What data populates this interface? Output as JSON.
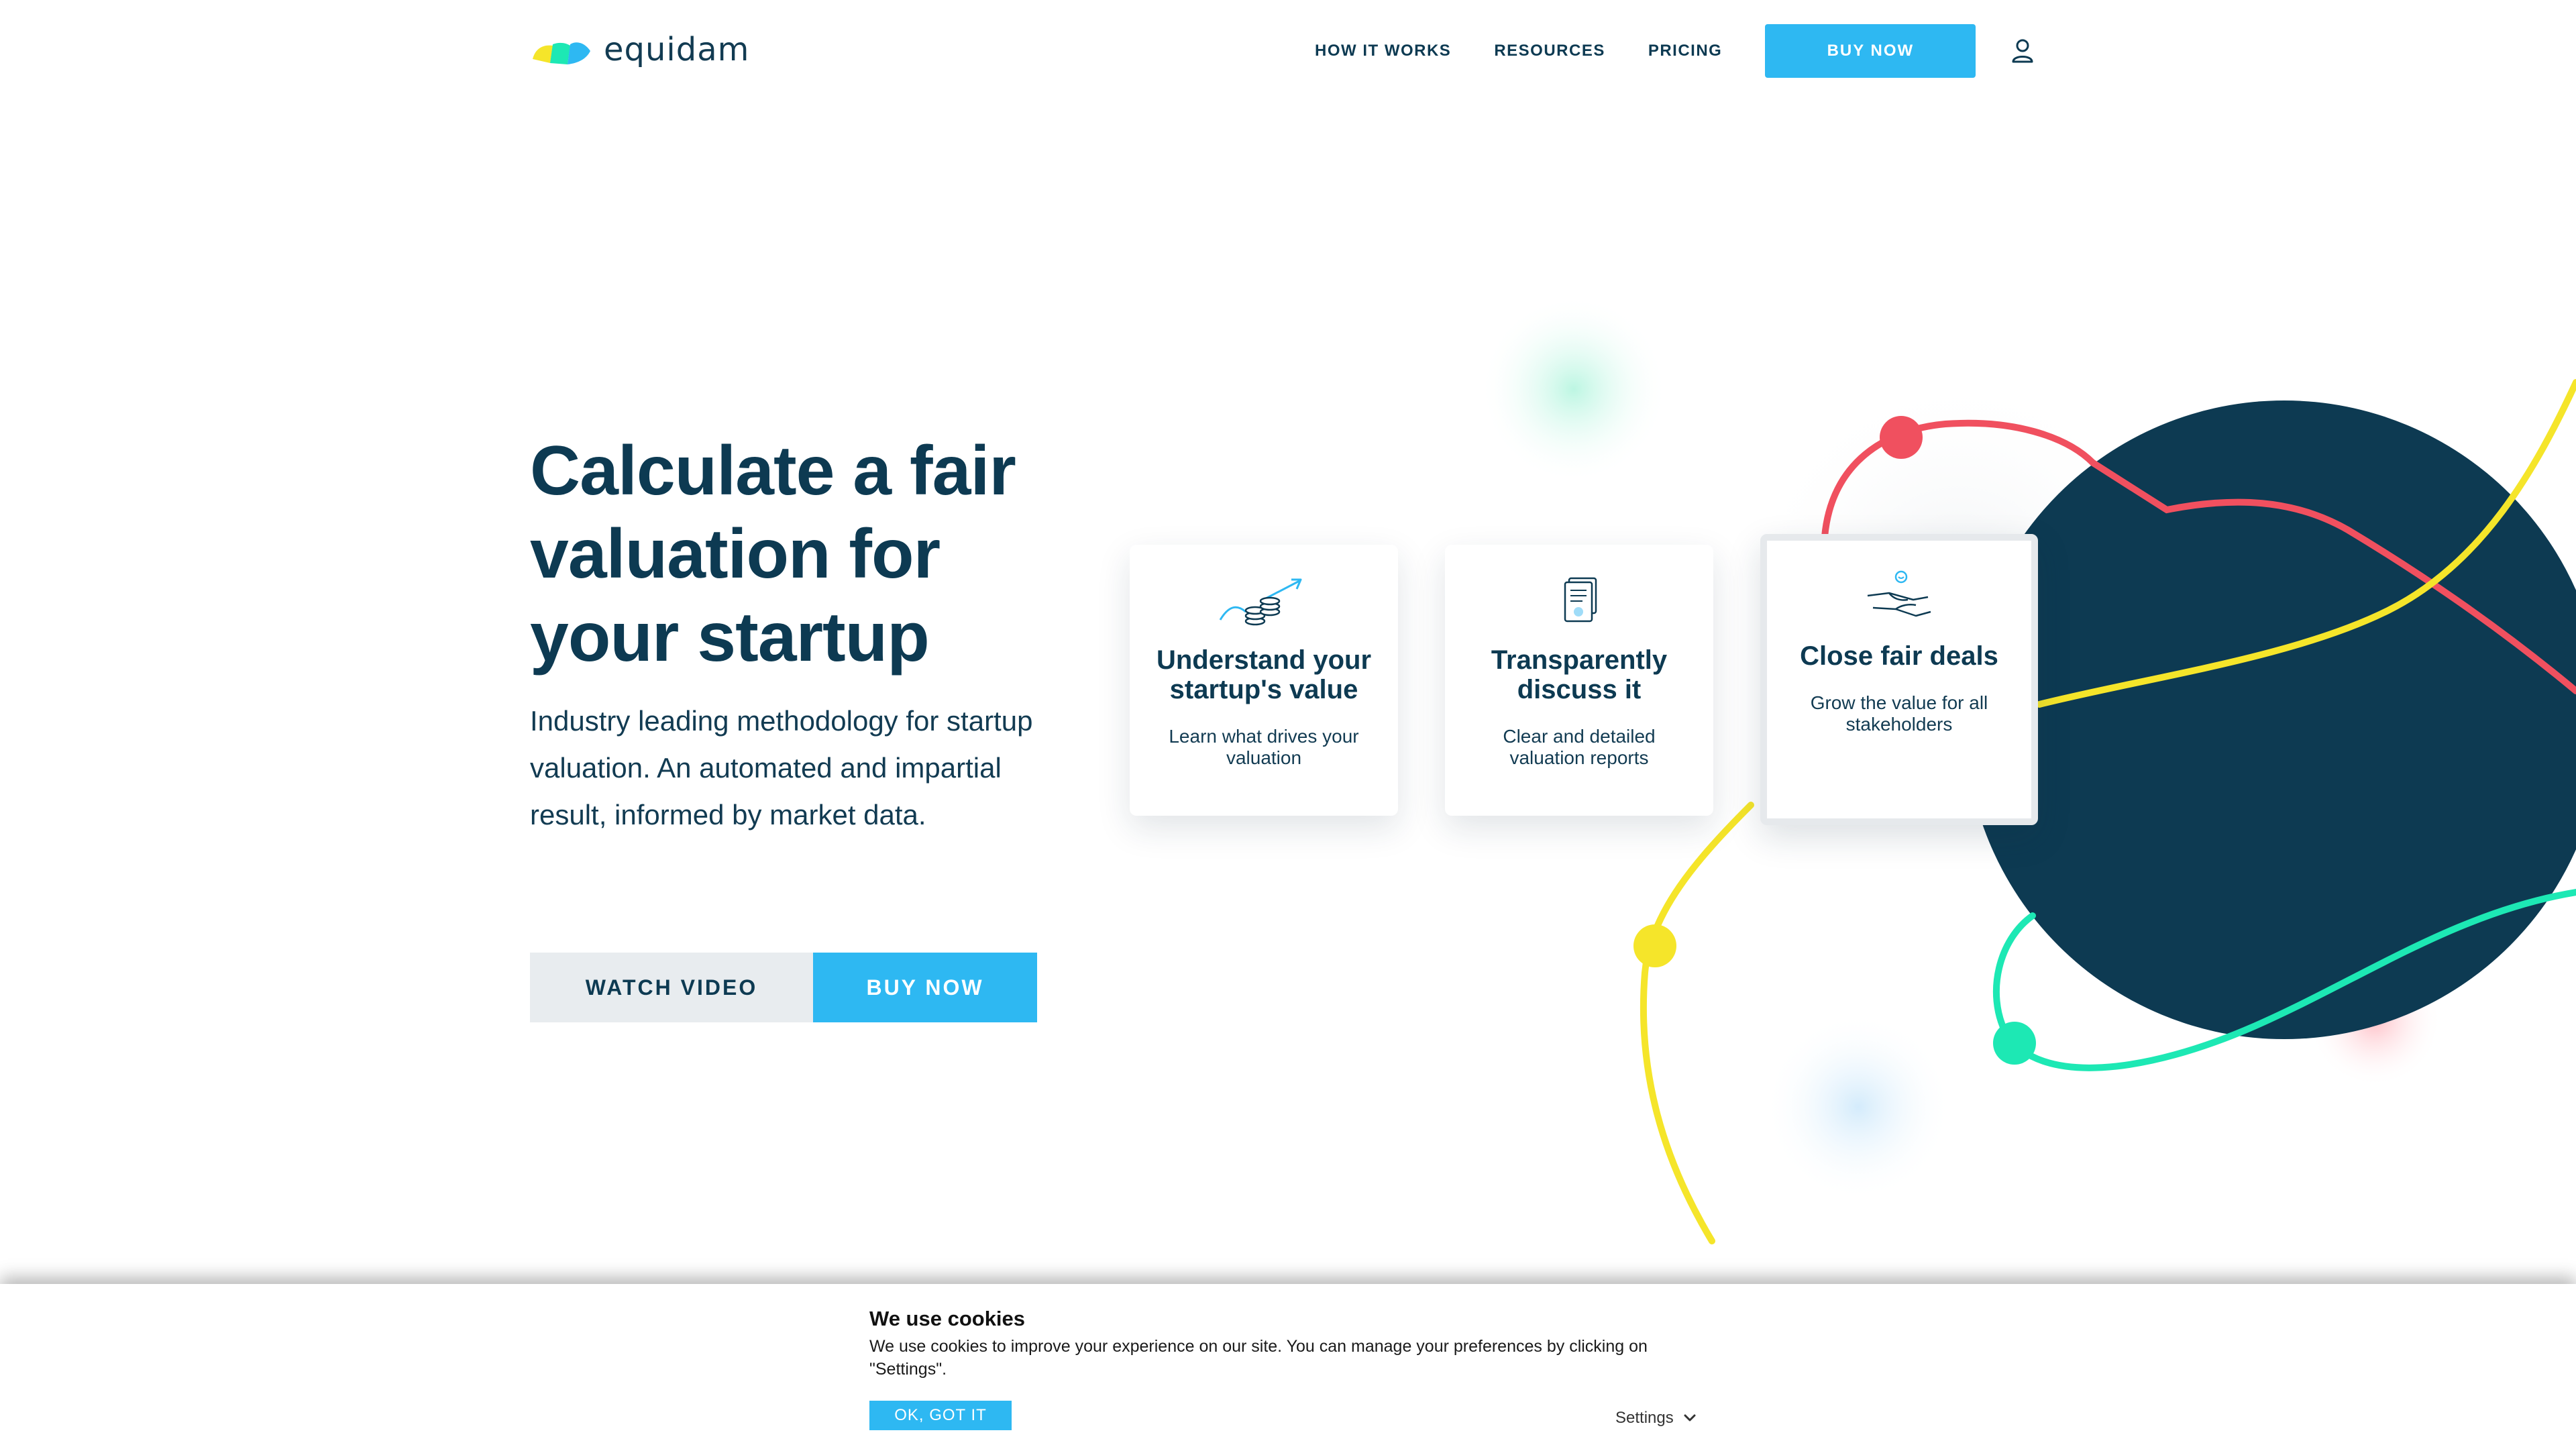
{
  "brand": {
    "name": "equidam"
  },
  "nav": {
    "links": [
      "HOW IT WORKS",
      "RESOURCES",
      "PRICING"
    ],
    "buy_label": "BUY NOW",
    "user_icon": "user-icon"
  },
  "hero": {
    "title": "Calculate a fair valuation for your startup",
    "subtitle": "Industry leading methodology for startup valuation. An automated and impartial result, informed by market data.",
    "watch_label": "WATCH VIDEO",
    "buy_label": "BUY NOW"
  },
  "cards": [
    {
      "icon": "coins-growth-icon",
      "title": "Understand your startup's value",
      "text": "Learn what drives your valuation"
    },
    {
      "icon": "document-report-icon",
      "title": "Transparently discuss it",
      "text": "Clear and detailed valuation reports"
    },
    {
      "icon": "handshake-icon",
      "title": "Close fair deals",
      "text": "Grow the value for all stakeholders"
    }
  ],
  "cookie": {
    "title": "We use cookies",
    "text": "We use cookies to improve your experience on our site. You can manage your preferences by clicking on \"Settings\".",
    "ok_label": "OK, GOT IT",
    "settings_label": "Settings"
  },
  "colors": {
    "navy": "#0d3a52",
    "accent": "#2eb8f2",
    "red": "#f0505f",
    "yellow": "#f5e52a",
    "green": "#1de8b4"
  }
}
